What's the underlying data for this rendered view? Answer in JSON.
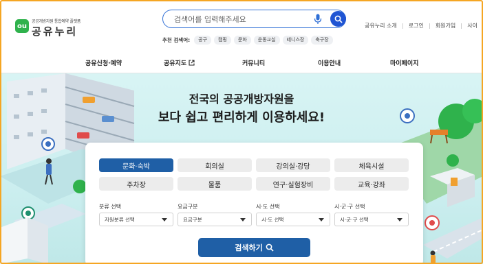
{
  "brand": {
    "badge": "ou",
    "subtitle": "공공개방자원 통합예약 플랫폼",
    "name": "공유누리"
  },
  "search": {
    "placeholder": "검색어를 입력해주세요",
    "recommend_label": "추천 검색어:",
    "keywords": [
      "공구",
      "캠핑",
      "문화",
      "운동교실",
      "테니스장",
      "축구장"
    ]
  },
  "util_links": [
    "공유누리 소개",
    "로그인",
    "회원가입",
    "사이"
  ],
  "nav": [
    "공유신청·예약",
    "공유지도",
    "커뮤니티",
    "이용안내",
    "마이페이지"
  ],
  "hero": {
    "line1": "전국의 공공개방자원을",
    "line2": "보다 쉽고 편리하게 이용하세요!"
  },
  "categories": [
    "문화·숙박",
    "회의실",
    "강의실·강당",
    "체육시설",
    "주차장",
    "물품",
    "연구·실험장비",
    "교육·강좌"
  ],
  "filters": [
    {
      "label": "분류 선택",
      "value": "자원분류 선택"
    },
    {
      "label": "요금구분",
      "value": "요금구분"
    },
    {
      "label": "시·도 선택",
      "value": "시·도 선택"
    },
    {
      "label": "시·군·구 선택",
      "value": "시·군·구 선택"
    }
  ],
  "search_button": "검색하기",
  "colors": {
    "accent": "#1f5fa6",
    "search_border": "#2f6fd6",
    "brand_green": "#2fb24c"
  }
}
